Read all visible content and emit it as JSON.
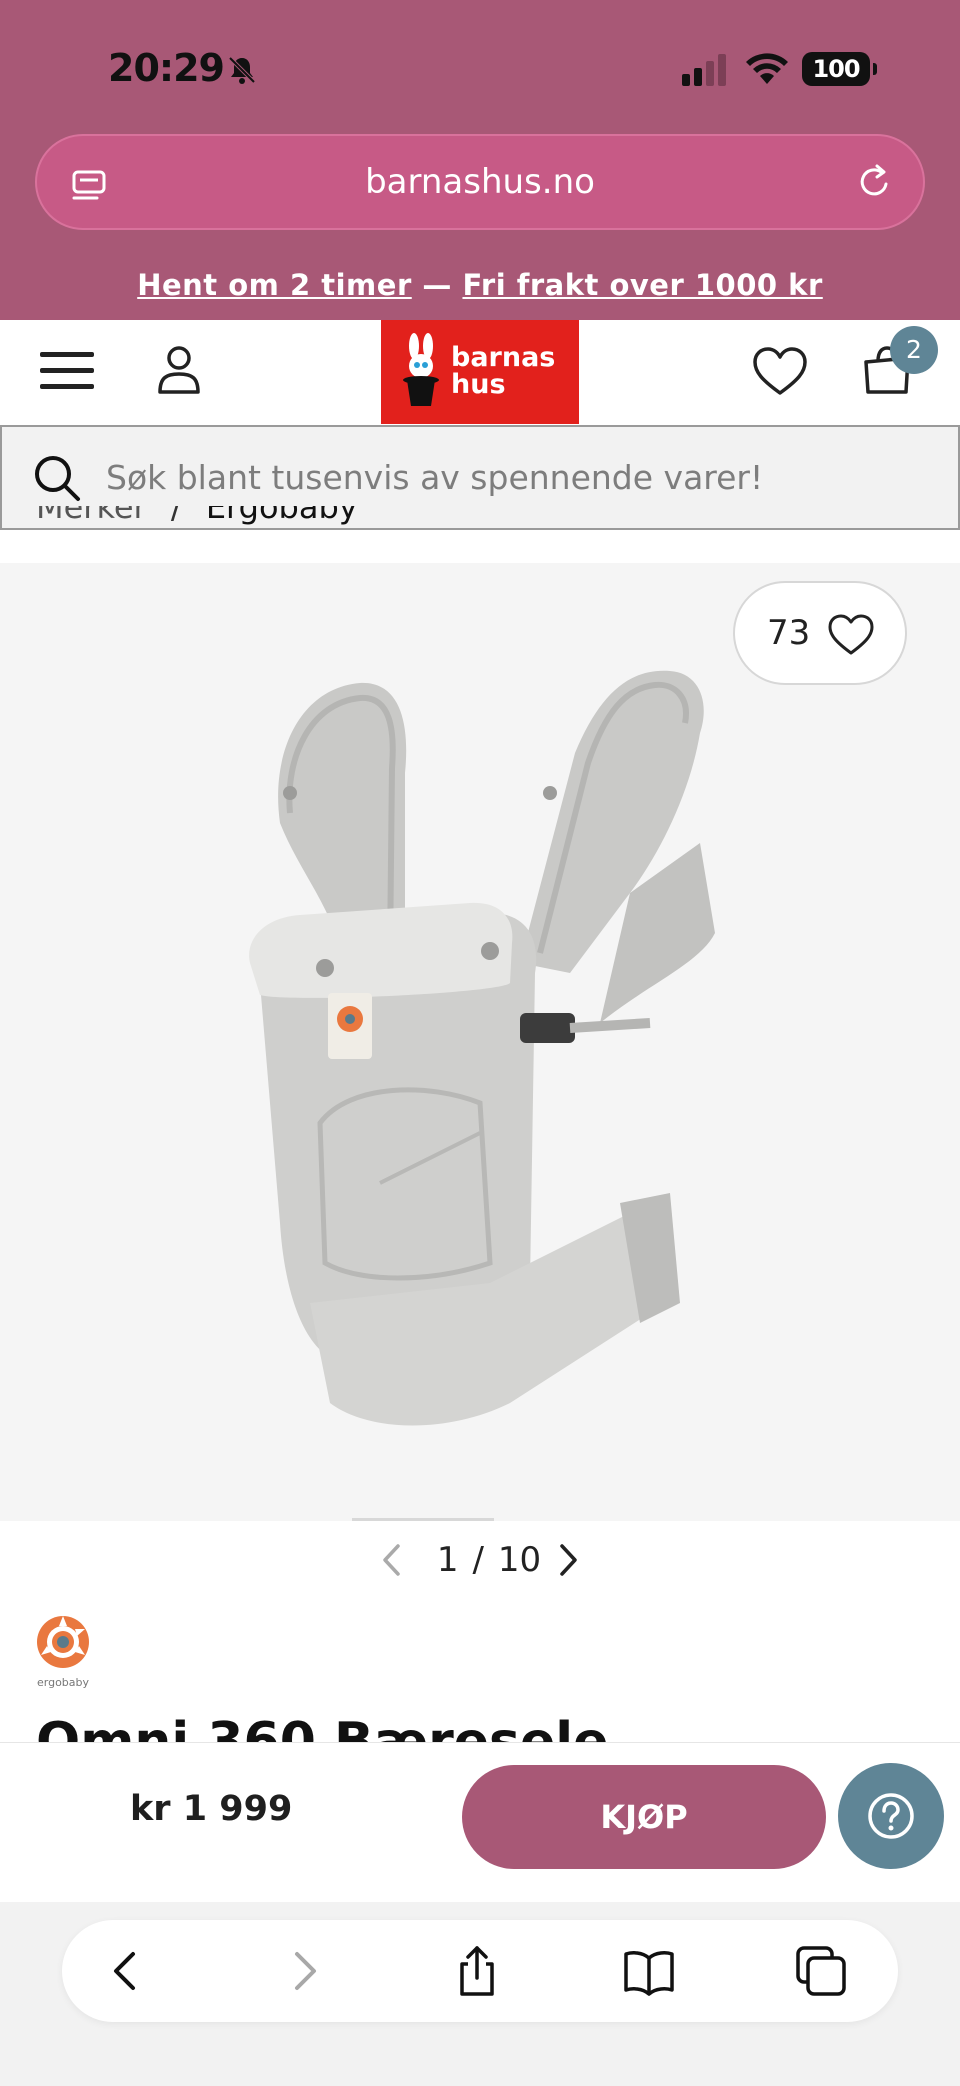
{
  "status_bar": {
    "time": "20:29",
    "battery": "100"
  },
  "browser": {
    "url": "barnashus.no"
  },
  "promo": {
    "part1": "Hent om 2 timer",
    "separator": " — ",
    "part2": "Fri frakt over 1000 kr"
  },
  "header": {
    "logo_line1": "barnas",
    "logo_line2": "hus",
    "cart_count": "2"
  },
  "search": {
    "placeholder": "Søk blant tusenvis av spennende varer!"
  },
  "breadcrumb": {
    "items": [
      "Merker",
      "Ergobaby"
    ],
    "separator": "/"
  },
  "product": {
    "likes": "73",
    "image_index": "1",
    "image_total": "10",
    "brand": "ergobaby",
    "title": "Omni 360 Bæresele",
    "price": "kr 1 999",
    "buy_label": "KJØP"
  },
  "colors": {
    "brand": "#a85876",
    "accent": "#5f8596",
    "logo_red": "#e2211c"
  },
  "icons": [
    "bell-off-icon",
    "signal-icon",
    "wifi-icon",
    "tabs-icon",
    "reload-icon",
    "menu-icon",
    "user-icon",
    "heart-icon",
    "bag-icon",
    "search-icon",
    "chevron-left-icon",
    "chevron-right-icon",
    "help-icon",
    "back-icon",
    "forward-icon",
    "share-icon",
    "bookmarks-icon",
    "tabs-overview-icon"
  ]
}
